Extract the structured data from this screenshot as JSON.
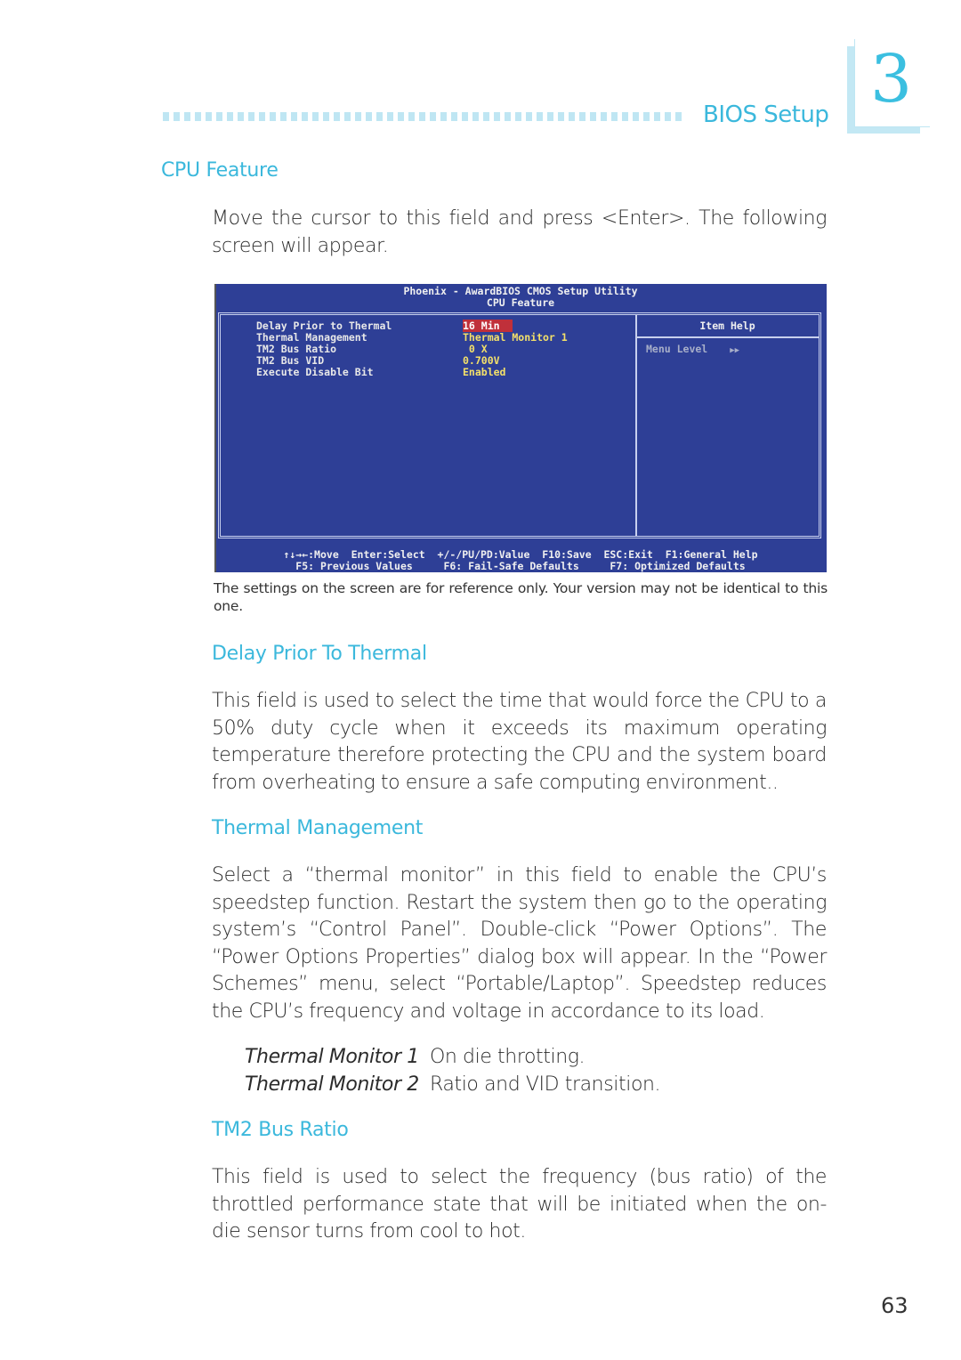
{
  "header": {
    "chapter_title": "BIOS Setup",
    "chapter_number": "3"
  },
  "section": {
    "title": "CPU Feature",
    "intro": "Move the cursor to this field and press <Enter>. The following screen will appear."
  },
  "bios_screen": {
    "title_line1": "Phoenix - AwardBIOS CMOS Setup Utility",
    "title_line2": "CPU Feature",
    "items": [
      {
        "label": "Delay Prior to Thermal",
        "value": "16 Min",
        "selected": true
      },
      {
        "label": "Thermal Management",
        "value": "Thermal Monitor 1",
        "selected": false
      },
      {
        "label": "TM2 Bus Ratio",
        "value": " 0 X",
        "selected": false
      },
      {
        "label": "TM2 Bus VID",
        "value": "0.700V",
        "selected": false
      },
      {
        "label": "Execute Disable Bit",
        "value": "Enabled",
        "selected": false
      }
    ],
    "help_title": "Item Help",
    "menu_level_label": "Menu Level",
    "menu_level_icon": "double-right-arrow",
    "menu_level_glyph": "▶▶",
    "footer_line1": "↑↓→←:Move  Enter:Select  +/-/PU/PD:Value  F10:Save  ESC:Exit  F1:General Help",
    "footer_line2": "F5: Previous Values     F6: Fail-Safe Defaults     F7: Optimized Defaults",
    "colors": {
      "background": "#2e3f96",
      "value": "#f3e06a",
      "selection": "#c0303a"
    }
  },
  "screen_note": "The settings on the screen are for reference only. Your version may not be identical to this one.",
  "subsections": [
    {
      "title": "Delay Prior To Thermal",
      "body": "This field is used to select the time that would force the CPU to a 50% duty cycle when it exceeds its maximum operating temperature therefore protecting the CPU and the system board from overheating to ensure a safe computing environment.."
    },
    {
      "title": "Thermal Management",
      "body": "Select a “thermal monitor” in this field to enable the CPU’s speedstep function. Restart the system then go to the operating system’s “Control Panel”. Double-click “Power Options”. The “Power Options Properties” dialog box will appear. In the “Power Schemes” menu, select “Portable/Laptop”. Speedstep reduces the CPU’s frequency and voltage in accordance to its load.",
      "options": [
        {
          "name": "Thermal Monitor 1",
          "desc": "On die throtting."
        },
        {
          "name": "Thermal Monitor 2",
          "desc": "Ratio and VID transition."
        }
      ]
    },
    {
      "title": "TM2 Bus Ratio",
      "body": "This field is used to select the frequency (bus ratio) of the throttled performance state that will be initiated when the on-die sensor turns from cool to hot."
    }
  ],
  "page_number": "63",
  "accent_color": "#3bb8dc"
}
